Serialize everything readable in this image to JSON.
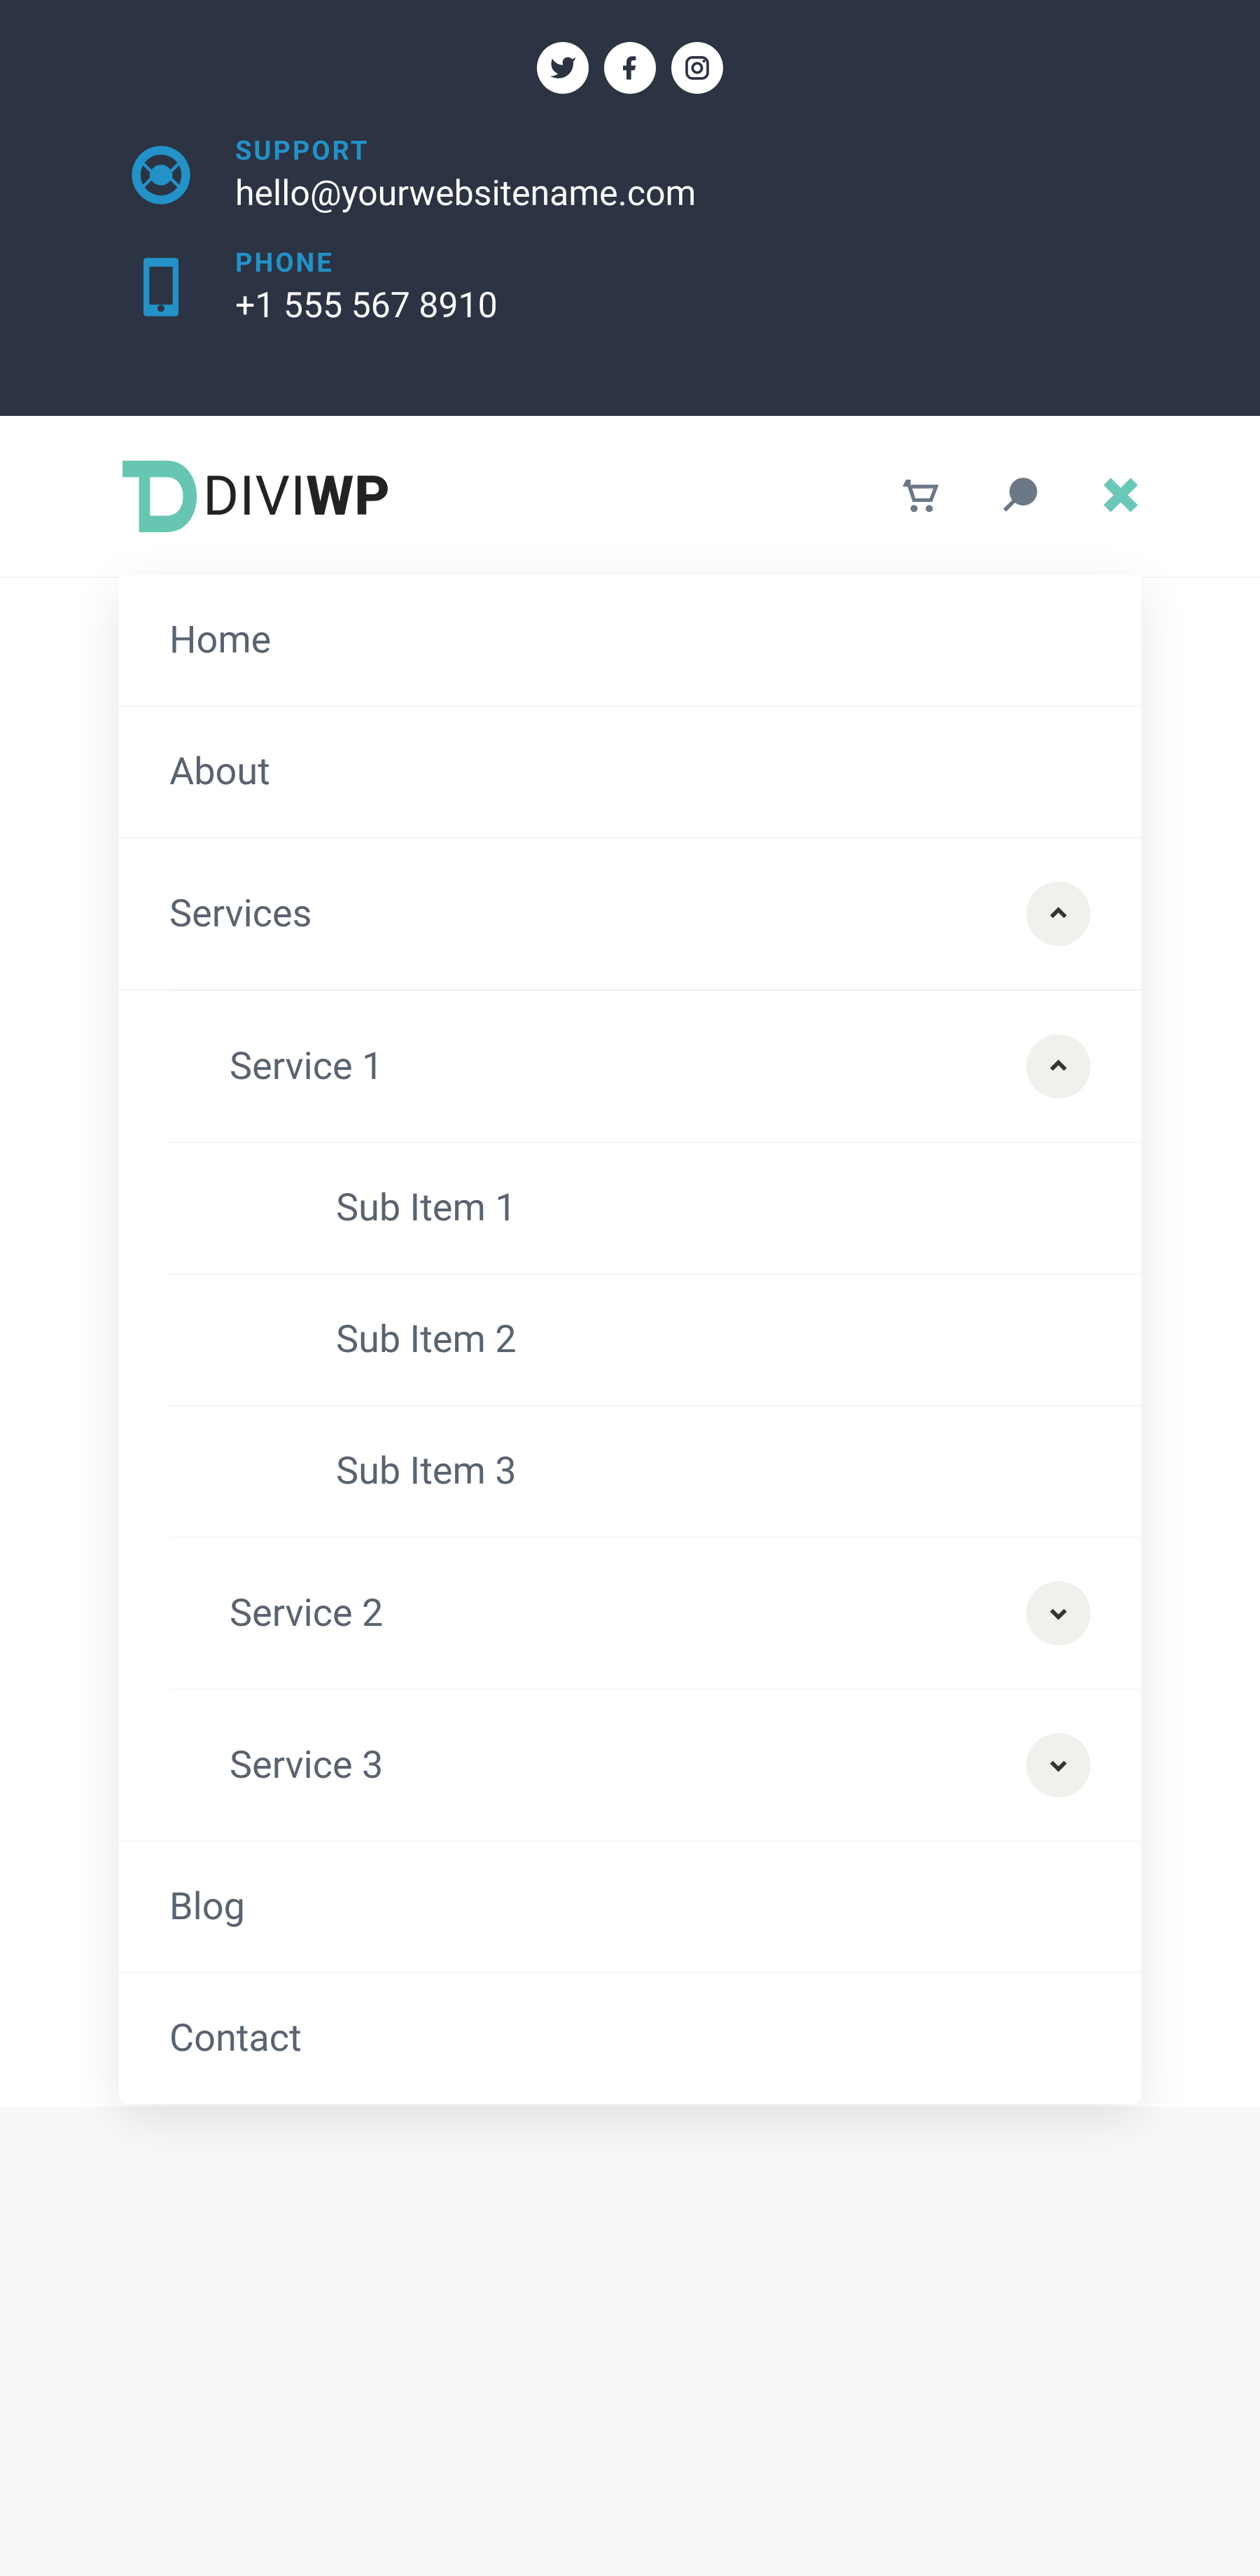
{
  "topbar": {
    "support": {
      "label": "SUPPORT",
      "value": "hello@yourwebsitename.com"
    },
    "phone": {
      "label": "PHONE",
      "value": "+1 555 567 8910"
    }
  },
  "logo": {
    "thin": "DIVI",
    "bold": "WP"
  },
  "menu": {
    "home": "Home",
    "about": "About",
    "services": "Services",
    "service1": "Service 1",
    "sub1": "Sub Item 1",
    "sub2": "Sub Item 2",
    "sub3": "Sub Item 3",
    "service2": "Service 2",
    "service3": "Service 3",
    "blog": "Blog",
    "contact": "Contact"
  }
}
